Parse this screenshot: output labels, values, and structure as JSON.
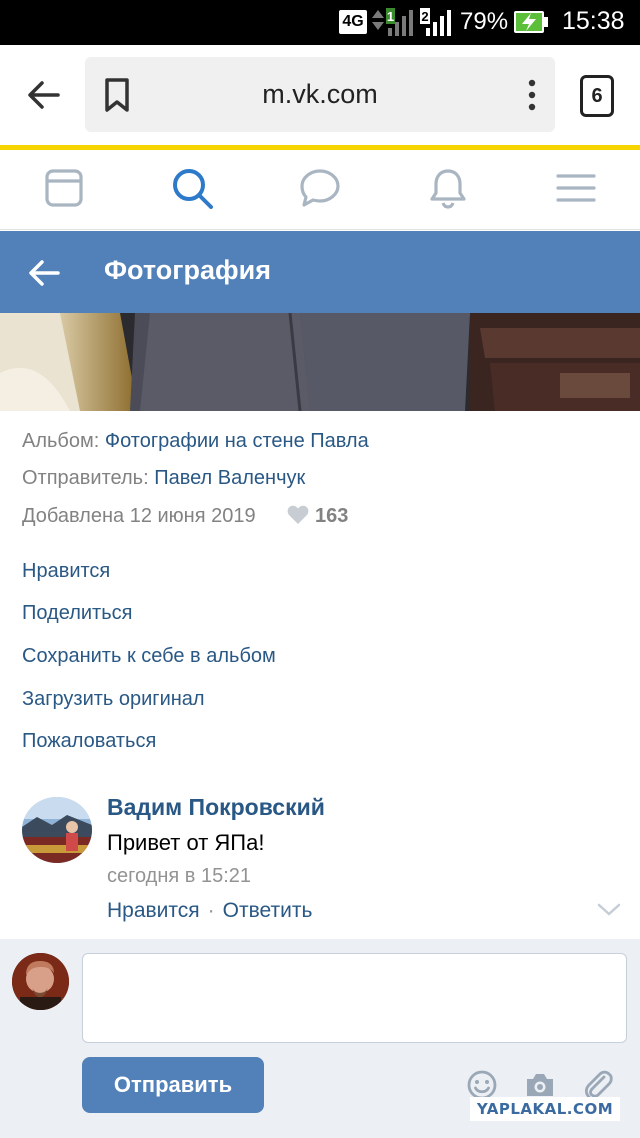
{
  "status_bar": {
    "network": "4G",
    "sim1": "1",
    "sim2": "2",
    "battery_percent": "79%",
    "time": "15:38"
  },
  "browser": {
    "url": "m.vk.com",
    "tabs_count": "6"
  },
  "nav": {
    "icons": [
      "news-icon",
      "search-icon",
      "messages-icon",
      "notifications-icon",
      "menu-icon"
    ],
    "active": "search-icon",
    "active_color": "#2c7ac9"
  },
  "header": {
    "title": "Фотография",
    "bg_color": "#5181b8"
  },
  "info": {
    "album_label": "Альбом:",
    "album_value": "Фотографии на стене Павла",
    "sender_label": "Отправитель:",
    "sender_value": "Павел Валенчук",
    "added": "Добавлена 12 июня 2019",
    "likes": "163"
  },
  "actions": {
    "like": "Нравится",
    "share": "Поделиться",
    "save": "Сохранить к себе в альбом",
    "download": "Загрузить оригинал",
    "report": "Пожаловаться"
  },
  "comment": {
    "author": "Вадим Покровский",
    "text": "Привет от ЯПа!",
    "time": "сегодня в 15:21",
    "like_label": "Нравится",
    "separator": "·",
    "reply_label": "Ответить"
  },
  "compose": {
    "send_label": "Отправить",
    "tool_icons": [
      "smile-icon",
      "camera-icon",
      "paperclip-icon"
    ]
  },
  "watermark": "YAPLAKAL.COM"
}
